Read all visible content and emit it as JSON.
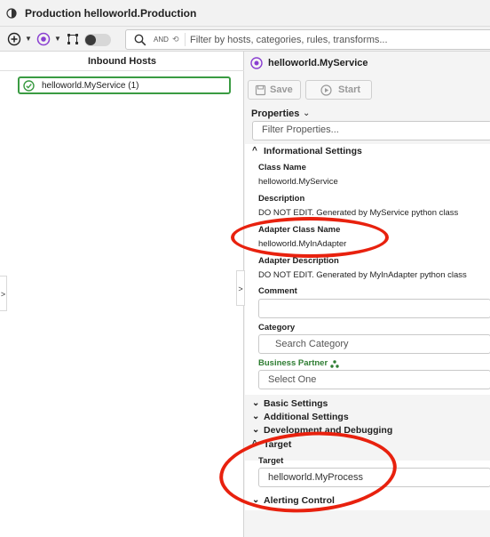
{
  "window": {
    "title": "Production helloworld.Production",
    "title_icon": "circle-split-icon"
  },
  "toolbar": {
    "search": {
      "and_label": "AND",
      "placeholder": "Filter by hosts, categories, rules, transforms..."
    }
  },
  "inbound": {
    "header": "Inbound Hosts",
    "items": [
      {
        "label": "helloworld.MyService (1)",
        "status": "ok",
        "status_color": "#3a9b42"
      }
    ]
  },
  "service": {
    "title": "helloworld.MyService",
    "buttons": {
      "save": "Save",
      "start": "Start"
    },
    "properties_label": "Properties",
    "filter_placeholder": "Filter Properties...",
    "sections": {
      "informational": "Informational Settings",
      "basic": "Basic Settings",
      "additional": "Additional Settings",
      "development": "Development and Debugging",
      "target": "Target",
      "alerting": "Alerting Control"
    },
    "fields": {
      "class_name": {
        "label": "Class Name",
        "value": "helloworld.MyService"
      },
      "description": {
        "label": "Description",
        "value": "DO NOT EDIT. Generated by MyService python class"
      },
      "adapter_class_name": {
        "label": "Adapter Class Name",
        "value": "helloworld.MyInAdapter"
      },
      "adapter_description": {
        "label": "Adapter Description",
        "value": "DO NOT EDIT. Generated by MyInAdapter python class"
      },
      "comment": {
        "label": "Comment",
        "value": ""
      },
      "category": {
        "label": "Category",
        "placeholder": "Search Category"
      },
      "business_partner": {
        "label": "Business Partner",
        "placeholder": "Select One"
      },
      "target": {
        "label": "Target",
        "value": "helloworld.MyProcess"
      }
    }
  },
  "colors": {
    "accent": "#8a3fd1",
    "ok": "#3a9b42",
    "annotation": "#e8210e",
    "business_partner": "#2e7d32"
  }
}
